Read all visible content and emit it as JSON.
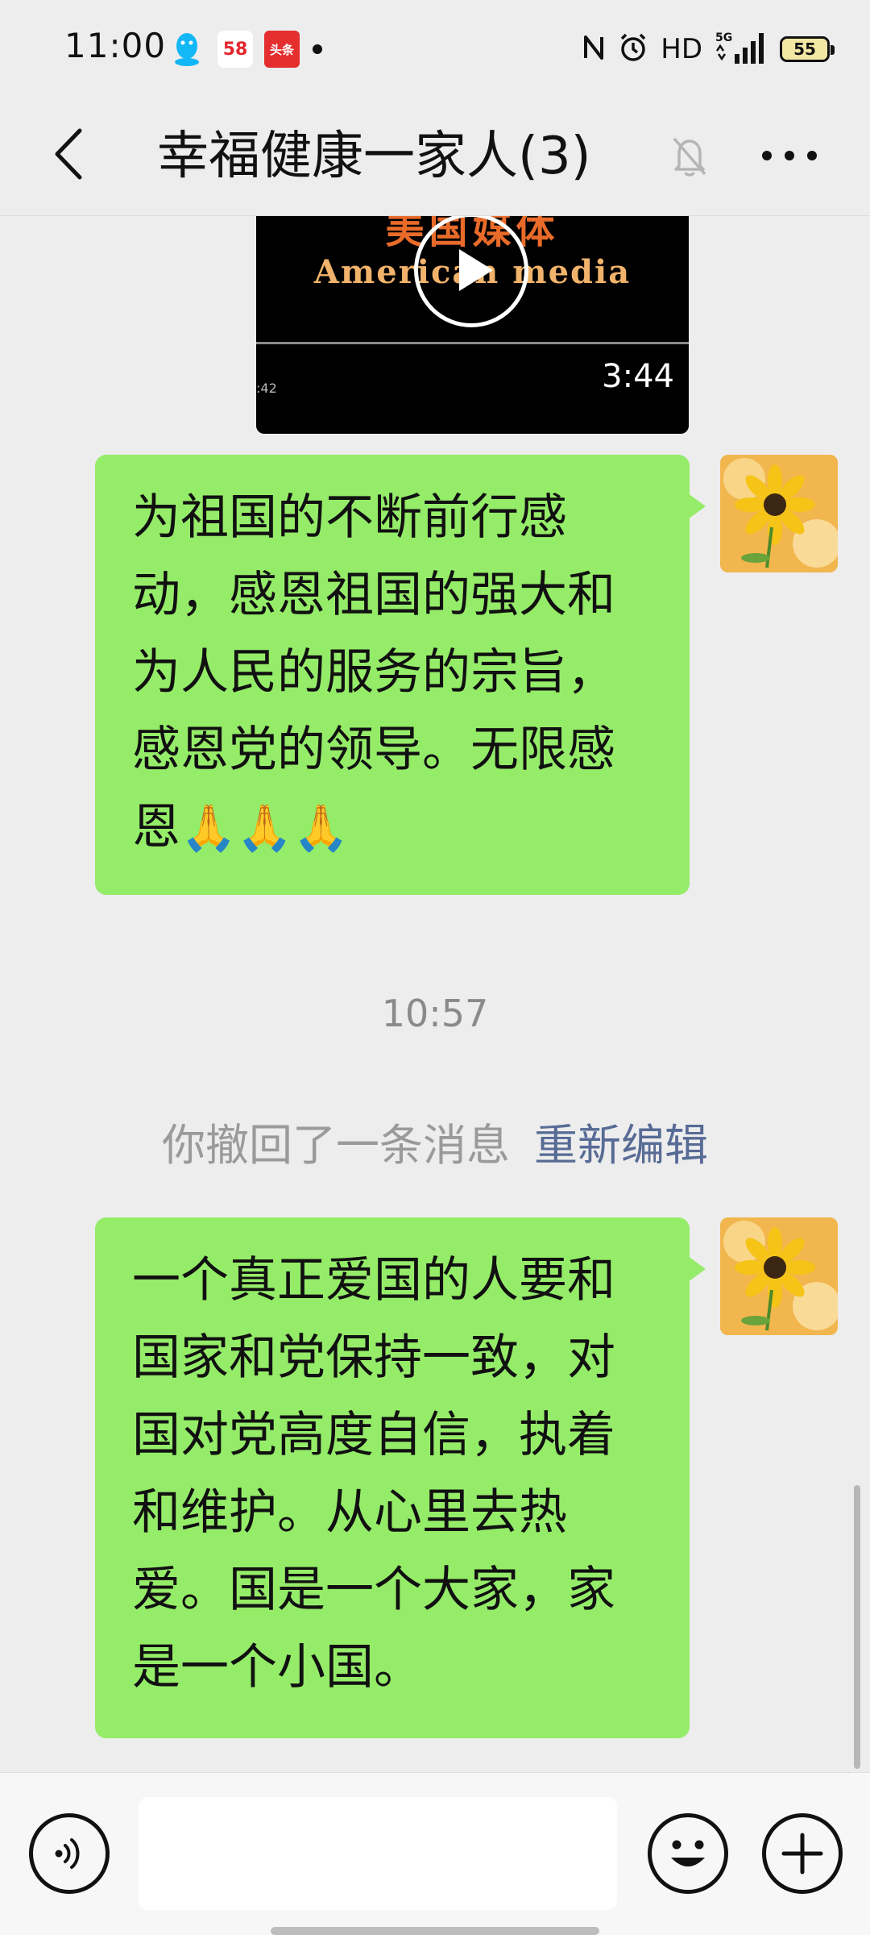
{
  "status_bar": {
    "time": "11:00",
    "app_58_label": "58",
    "app_toutiao_label": "头条",
    "hd_label": "HD",
    "network_label": "5G",
    "battery_level": "55"
  },
  "header": {
    "title": "幸福健康一家人(3)"
  },
  "video": {
    "overlay_cn": "美国媒体",
    "overlay_en": "American media",
    "elapsed": ":42",
    "duration": "3:44"
  },
  "messages": [
    {
      "lines": [
        "为祖国的不断前行感",
        "动，感恩祖国的强大和",
        "为人民的服务的宗旨，",
        "感恩党的领导。无限感",
        "恩"
      ],
      "emoji": "🙏🙏🙏"
    },
    {
      "lines": [
        "一个真正爱国的人要和",
        "国家和党保持一致，对",
        "国对党高度自信，执着",
        "和维护。从心里去热",
        "爱。国是一个大家，家",
        "是一个小国。"
      ]
    }
  ],
  "timestamp": "10:57",
  "recall": {
    "text": "你撤回了一条消息",
    "edit_label": "重新编辑"
  },
  "input": {
    "value": "",
    "placeholder": ""
  },
  "colors": {
    "background": "#ededed",
    "bubble": "#95ec69",
    "link": "#576b95"
  }
}
